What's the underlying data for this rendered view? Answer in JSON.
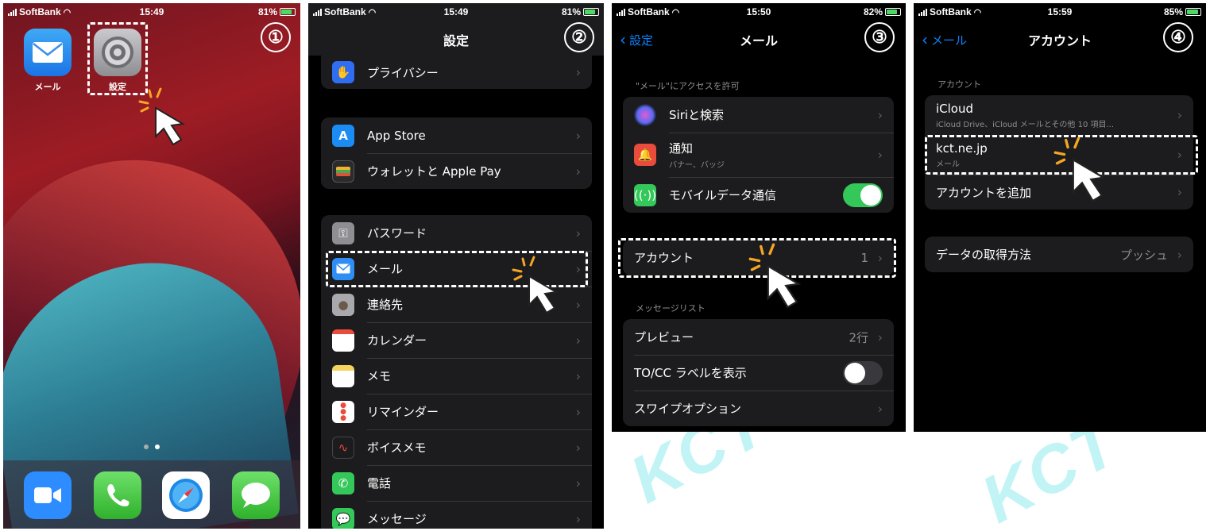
{
  "status": {
    "carrier": "SoftBank",
    "p1": {
      "time": "15:49",
      "battery": "81%"
    },
    "p2": {
      "time": "15:49",
      "battery": "81%"
    },
    "p3": {
      "time": "15:50",
      "battery": "82%"
    },
    "p4": {
      "time": "15:59",
      "battery": "85%"
    }
  },
  "steps": [
    "①",
    "②",
    "③",
    "④"
  ],
  "home": {
    "apps": [
      {
        "label": "メール",
        "icon": "mail-icon"
      },
      {
        "label": "設定",
        "icon": "settings-gear-icon"
      }
    ],
    "dock": [
      {
        "icon": "zoom-icon"
      },
      {
        "icon": "phone-icon"
      },
      {
        "icon": "safari-icon"
      },
      {
        "icon": "messages-icon"
      }
    ]
  },
  "settings": {
    "title": "設定",
    "group1": [
      {
        "label": "プライバシー",
        "icon": "hand-icon",
        "color": "#2f6ef2"
      }
    ],
    "group2": [
      {
        "label": "App Store",
        "icon": "app-store-icon",
        "color": "#1c8cf5"
      },
      {
        "label": "ウォレットと Apple Pay",
        "icon": "wallet-icon",
        "color": "#2b2b2b"
      }
    ],
    "group3": [
      {
        "label": "パスワード",
        "icon": "key-icon",
        "color": "#8e8e93"
      },
      {
        "label": "メール",
        "icon": "mail-icon",
        "color": "#2f8ef5"
      },
      {
        "label": "連絡先",
        "icon": "contacts-icon",
        "color": "#a8a8ad"
      },
      {
        "label": "カレンダー",
        "icon": "calendar-icon",
        "color": "#ffffff"
      },
      {
        "label": "メモ",
        "icon": "notes-icon",
        "color": "#f4d35e"
      },
      {
        "label": "リマインダー",
        "icon": "reminders-icon",
        "color": "#ffffff"
      },
      {
        "label": "ボイスメモ",
        "icon": "voice-memo-icon",
        "color": "#1c1c1e"
      },
      {
        "label": "電話",
        "icon": "phone-icon",
        "color": "#34c759"
      },
      {
        "label": "メッセージ",
        "icon": "messages-icon",
        "color": "#34c759"
      }
    ]
  },
  "mail": {
    "back": "設定",
    "title": "メール",
    "access_header": "\"メール\"にアクセスを許可",
    "access": [
      {
        "label": "Siriと検索",
        "icon": "siri-icon"
      },
      {
        "label": "通知",
        "sub": "バナー、バッジ",
        "icon": "notifications-icon"
      },
      {
        "label": "モバイルデータ通信",
        "icon": "cellular-icon",
        "toggle": "on"
      }
    ],
    "accounts_label": "アカウント",
    "accounts_value": "1",
    "messages_header": "メッセージリスト",
    "messages": [
      {
        "label": "プレビュー",
        "value": "2行"
      },
      {
        "label": "TO/CC ラベルを表示",
        "toggle": "off"
      },
      {
        "label": "スワイプオプション"
      }
    ]
  },
  "accounts": {
    "back": "メール",
    "title": "アカウント",
    "section_header": "アカウント",
    "items": [
      {
        "label": "iCloud",
        "sub": "iCloud Drive、iCloud メールとその他 10 項目..."
      },
      {
        "label": "kct.ne.jp",
        "sub": "メール"
      },
      {
        "label": "アカウントを追加"
      }
    ],
    "fetch_label": "データの取得方法",
    "fetch_value": "プッシュ"
  },
  "watermarks": [
    "KCT",
    "KCT"
  ]
}
